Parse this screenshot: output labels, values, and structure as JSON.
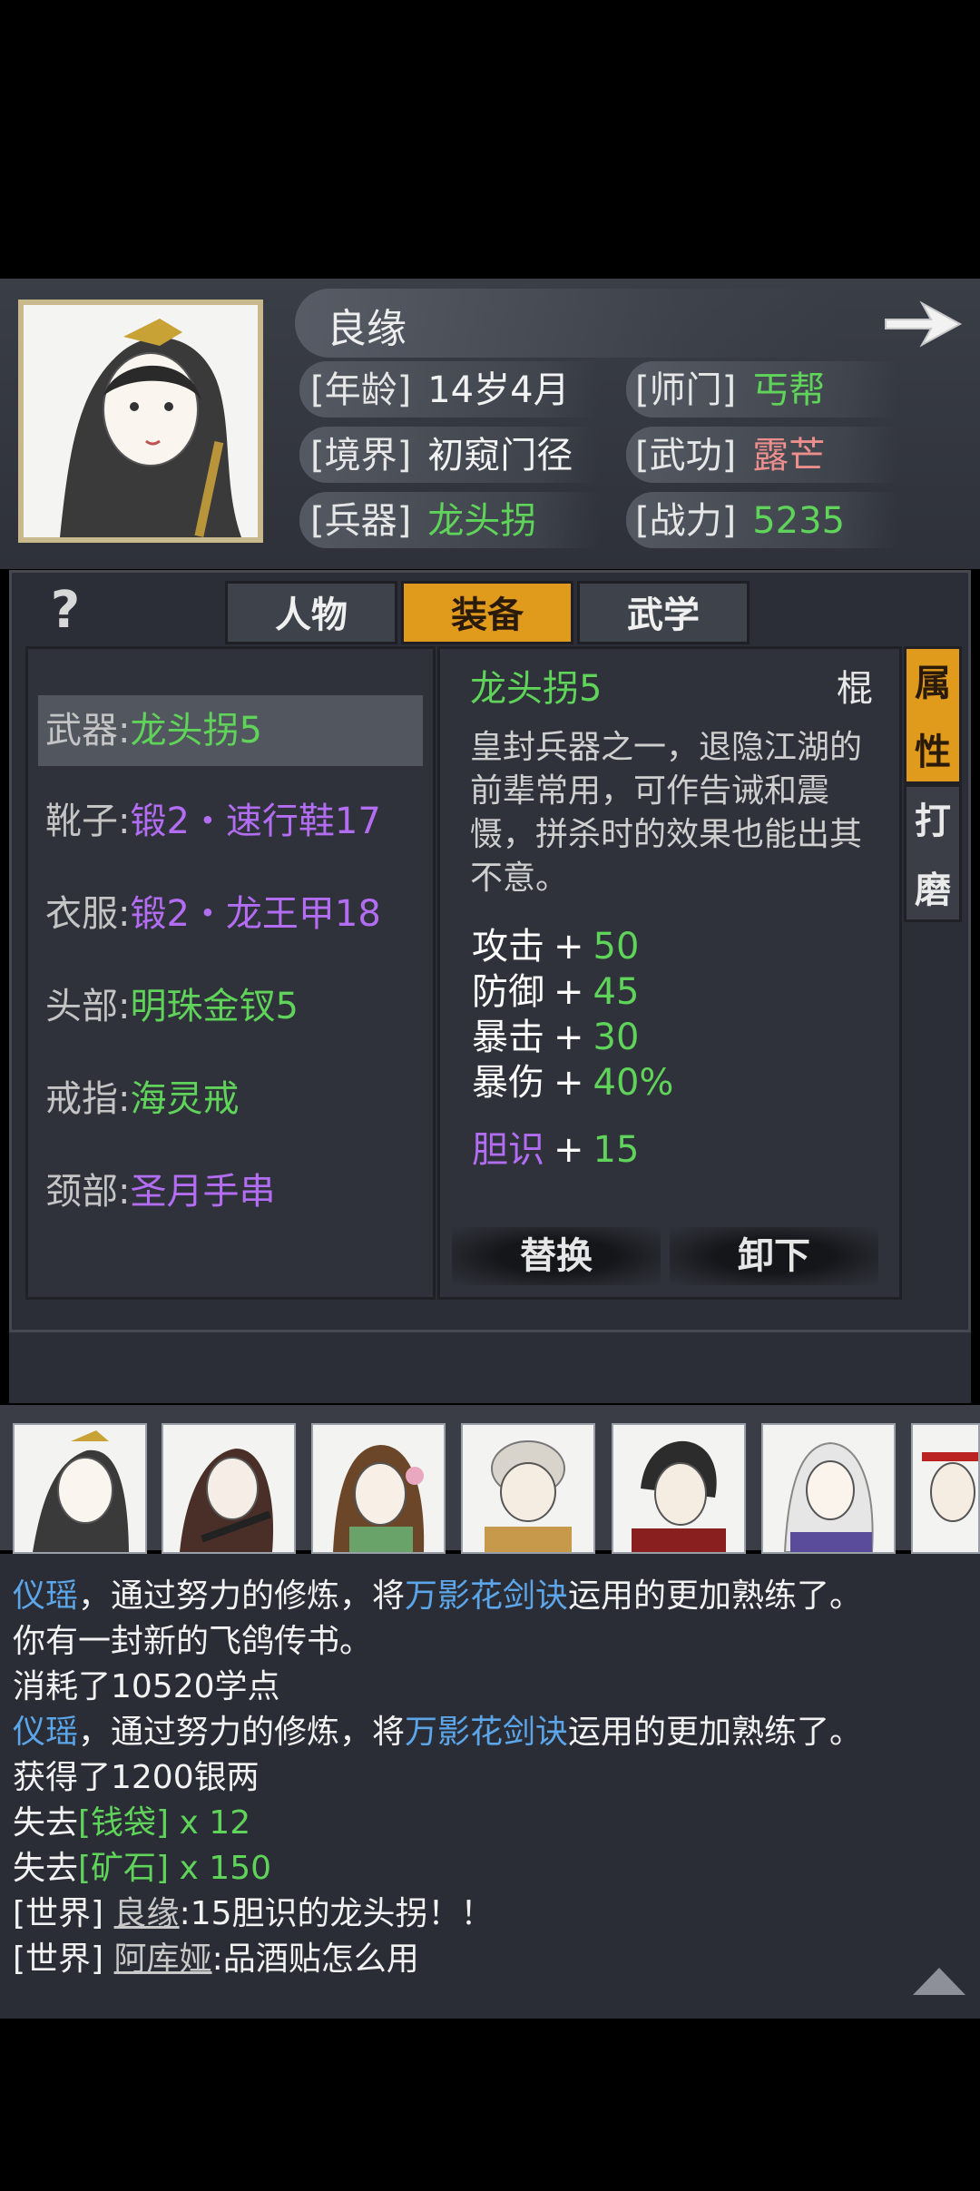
{
  "character": {
    "name": "良缘",
    "stats": [
      {
        "key": "[年龄]",
        "value": "14岁4月",
        "color": "white"
      },
      {
        "key": "[师门]",
        "value": "丐帮",
        "color": "green"
      },
      {
        "key": "[境界]",
        "value": "初窥门径",
        "color": "white"
      },
      {
        "key": "[武功]",
        "value": "露芒",
        "color": "pink"
      },
      {
        "key": "[兵器]",
        "value": "龙头拐",
        "color": "green"
      },
      {
        "key": "[战力]",
        "value": "5235",
        "color": "green"
      }
    ]
  },
  "tabs": [
    {
      "label": "人物",
      "active": false
    },
    {
      "label": "装备",
      "active": true
    },
    {
      "label": "武学",
      "active": false
    }
  ],
  "slots": [
    {
      "key": "武器:",
      "value": "龙头拐5",
      "color": "green",
      "selected": true
    },
    {
      "key": "靴子:",
      "value": "锻2・速行鞋17",
      "color": "purple",
      "selected": false
    },
    {
      "key": "衣服:",
      "value": "锻2・龙王甲18",
      "color": "purple",
      "selected": false
    },
    {
      "key": "头部:",
      "value": "明珠金钗5",
      "color": "green",
      "selected": false
    },
    {
      "key": "戒指:",
      "value": "海灵戒",
      "color": "green",
      "selected": false
    },
    {
      "key": "颈部:",
      "value": "圣月手串",
      "color": "purple",
      "selected": false
    }
  ],
  "item": {
    "name": "龙头拐5",
    "type": "棍",
    "description": "皇封兵器之一，退隐江湖的前辈常用，可作告诫和震慑，拼杀时的效果也能出其不意。",
    "attributes": [
      {
        "key": "攻击",
        "op": "+",
        "value": "50"
      },
      {
        "key": "防御",
        "op": "+",
        "value": "45"
      },
      {
        "key": "暴击",
        "op": "+",
        "value": "30"
      },
      {
        "key": "暴伤",
        "op": "+",
        "value": "40%"
      }
    ],
    "bonus": {
      "key": "胆识",
      "op": "+",
      "value": "15"
    },
    "buttons": {
      "replace": "替换",
      "unequip": "卸下"
    }
  },
  "side_tabs": [
    {
      "label": "属性",
      "active": true
    },
    {
      "label": "打磨",
      "active": false
    }
  ],
  "chat": [
    [
      {
        "t": "仪瑶",
        "c": "blue"
      },
      {
        "t": "，通过努力的修炼，将",
        "c": "white"
      },
      {
        "t": "万影花剑诀",
        "c": "blue"
      },
      {
        "t": "运用的更加熟练了。",
        "c": "white"
      }
    ],
    [
      {
        "t": "你有一封新的飞鸽传书。",
        "c": "white"
      }
    ],
    [
      {
        "t": "消耗了10520学点",
        "c": "white"
      }
    ],
    [
      {
        "t": "仪瑶",
        "c": "blue"
      },
      {
        "t": "，通过努力的修炼，将",
        "c": "white"
      },
      {
        "t": "万影花剑诀",
        "c": "blue"
      },
      {
        "t": "运用的更加熟练了。",
        "c": "white"
      }
    ],
    [
      {
        "t": "获得了1200银两",
        "c": "white"
      }
    ],
    [
      {
        "t": "失去",
        "c": "white"
      },
      {
        "t": "[钱袋] x 12",
        "c": "green"
      }
    ],
    [
      {
        "t": "失去",
        "c": "white"
      },
      {
        "t": "[矿石] x 150",
        "c": "green"
      }
    ],
    [
      {
        "t": "[世界] ",
        "c": "white"
      },
      {
        "t": "良缘",
        "c": "gray-u"
      },
      {
        "t": ":15胆识的龙头拐！！",
        "c": "white"
      }
    ],
    [
      {
        "t": "[世界] ",
        "c": "white"
      },
      {
        "t": "阿库娅",
        "c": "gray-u"
      },
      {
        "t": ":品酒贴怎么用",
        "c": "white"
      }
    ]
  ],
  "icons": {
    "help": "?",
    "next": "arrow-right-icon",
    "scroll": "triangle-up-icon"
  }
}
